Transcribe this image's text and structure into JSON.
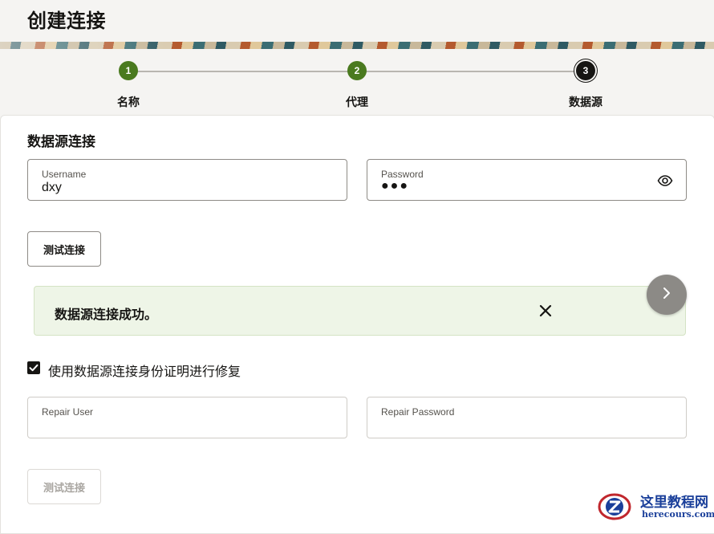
{
  "page": {
    "title": "创建连接"
  },
  "stepper": {
    "steps": [
      {
        "number": "1",
        "label": "名称",
        "status": "done"
      },
      {
        "number": "2",
        "label": "代理",
        "status": "done"
      },
      {
        "number": "3",
        "label": "数据源",
        "status": "current"
      }
    ]
  },
  "section": {
    "title": "数据源连接"
  },
  "username": {
    "label": "Username",
    "value": "dxy"
  },
  "password": {
    "label": "Password",
    "value": "●●●",
    "icon": "eye-icon"
  },
  "test_button": {
    "label": "测试连接"
  },
  "alert": {
    "message": "数据源连接成功。",
    "close_icon": "close-icon",
    "color": "#eef5e7"
  },
  "next_button": {
    "icon": "chevron-right-icon"
  },
  "repair_checkbox": {
    "checked": true,
    "label": "使用数据源连接身份证明进行修复"
  },
  "repair_user": {
    "label": "Repair User",
    "value": ""
  },
  "repair_password": {
    "label": "Repair Password",
    "value": ""
  },
  "repair_test_button": {
    "label": "测试连接",
    "disabled": true
  },
  "watermark": {
    "title": "这里教程网",
    "url": "herecours.com"
  },
  "colors": {
    "step_done": "#4a7a1f",
    "step_current": "#161513",
    "accent_text": "#161513",
    "watermark": "#1a3f9a"
  }
}
